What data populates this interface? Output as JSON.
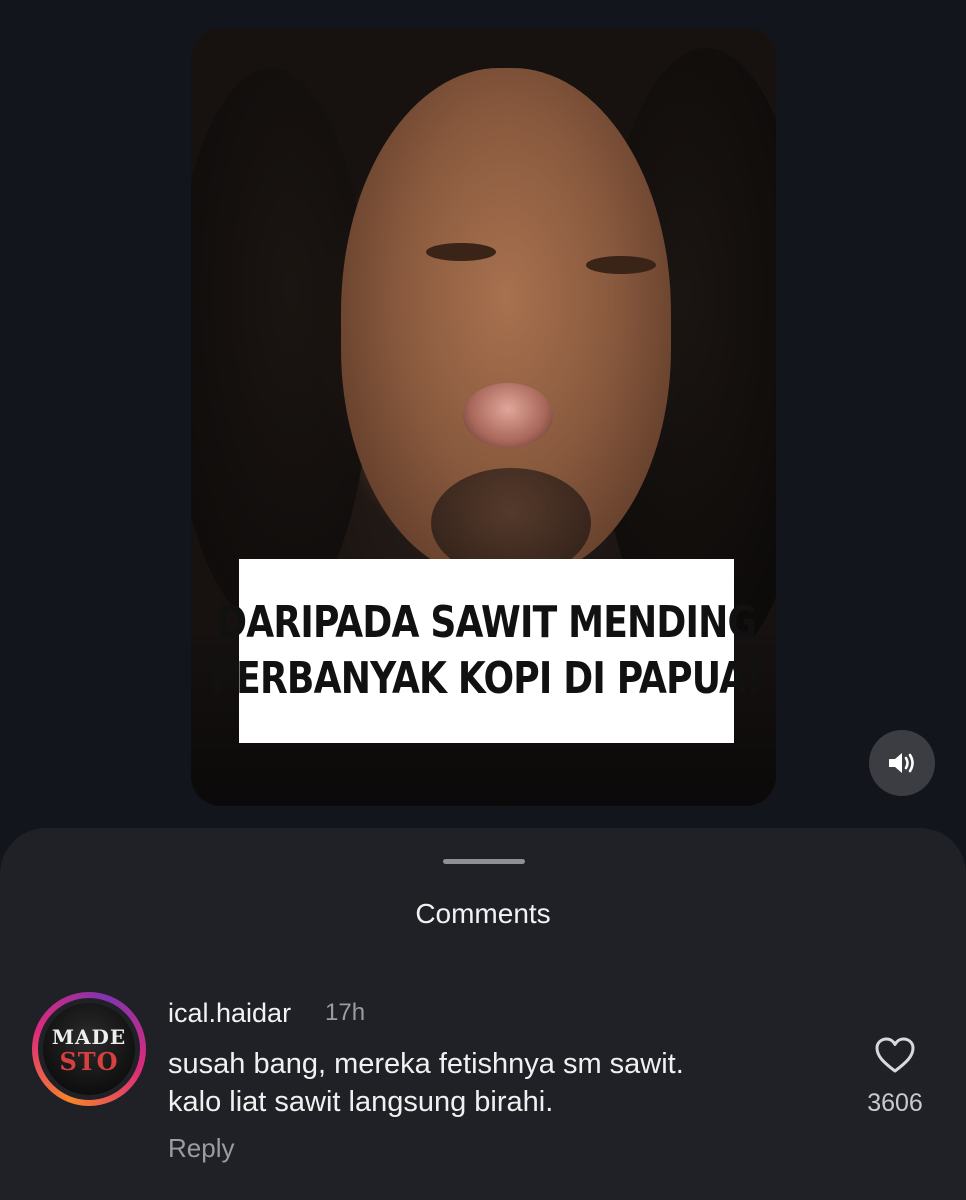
{
  "video": {
    "caption_line1": "DARIPADA SAWIT MENDING",
    "caption_line2": "PERBANYAK KOPI DI PAPUA!",
    "sound_icon": "speaker-volume-icon"
  },
  "comments_sheet": {
    "title": "Comments",
    "comment": {
      "avatar_logo_line1": "MADE",
      "avatar_logo_line2": "STO",
      "username": "ical.haidar",
      "time": "17h",
      "text_line1": "susah bang, mereka fetishnya sm sawit.",
      "text_line2": "kalo liat sawit langsung birahi.",
      "reply_label": "Reply",
      "like_icon": "heart-outline-icon",
      "like_count": "3606"
    }
  },
  "colors": {
    "background": "#12151b",
    "sheet": "#202126",
    "muted_text": "#9a9ca3",
    "story_ring": [
      "#f58529",
      "#dd2a7b",
      "#8134af"
    ]
  }
}
